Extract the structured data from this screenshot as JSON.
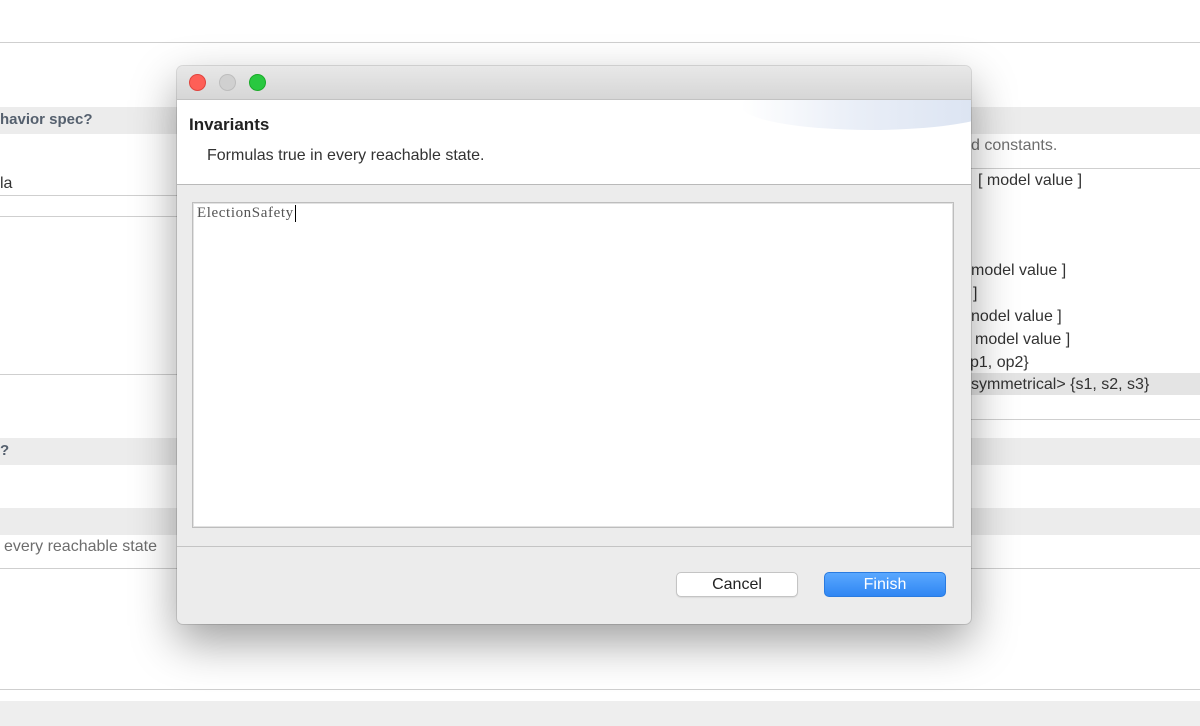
{
  "background": {
    "left_texts": {
      "heading_behavior": "havior spec?",
      "formula": "la",
      "heading_q": "?",
      "invariants_desc": "every reachable state"
    },
    "right_texts": {
      "constants_desc": "d constants.",
      "mv1": "[ model value ]",
      "mv2": "model value ]",
      "bracket": "]",
      "mv3": "nodel value ]",
      "mv4": "model value ]",
      "ops": "p1, op2}",
      "symm": "symmetrical> {s1, s2, s3}"
    }
  },
  "dialog": {
    "title": "Invariants",
    "description": "Formulas true in every reachable state.",
    "editor_text": "ElectionSafety",
    "buttons": {
      "cancel": "Cancel",
      "finish": "Finish"
    },
    "colors": {
      "close": "#fe5f57",
      "minimize": "#d0d0d0",
      "maximize": "#29c840",
      "accent": "#2f86f3"
    }
  }
}
